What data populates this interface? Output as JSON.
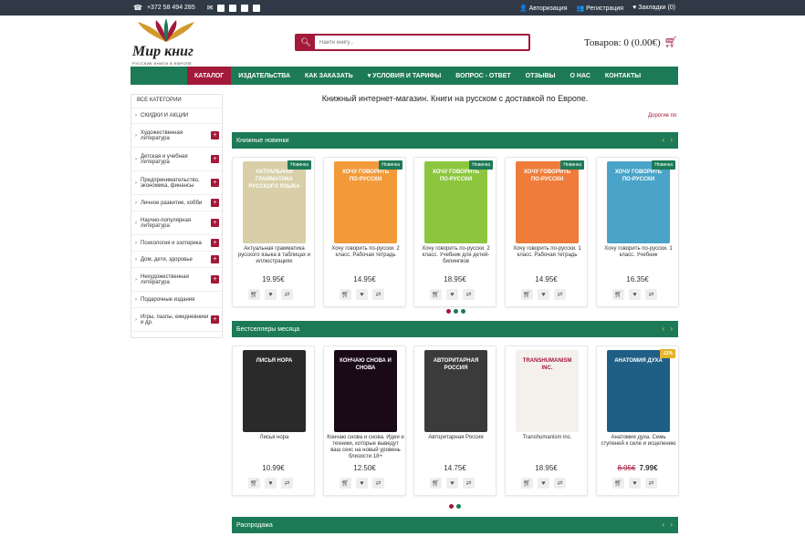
{
  "topbar": {
    "phone": "+372 58 494 285",
    "login": "Авторизация",
    "register": "Регистрация",
    "bookmarks": "Закладки (0)"
  },
  "logo": {
    "title": "Мир книг",
    "subtitle": "РУССКИЕ КНИГИ В ЕВРОПЕ"
  },
  "search": {
    "placeholder": "Найти книгу..."
  },
  "cart": {
    "label": "Товаров: 0 (0.00€)"
  },
  "nav": [
    "КАТАЛОГ",
    "ИЗДАТЕЛЬСТВА",
    "КАК ЗАКАЗАТЬ",
    "▾ УСЛОВИЯ И ТАРИФЫ",
    "ВОПРОС - ОТВЕТ",
    "ОТЗЫВЫ",
    "О НАС",
    "КОНТАКТЫ"
  ],
  "sidebar": {
    "header": "ВСЕ КАТЕГОРИИ",
    "items": [
      {
        "label": "СКИДКИ И АКЦИИ",
        "plus": false
      },
      {
        "label": "Художественная литература",
        "plus": true
      },
      {
        "label": "Детская и учебная литература",
        "plus": true
      },
      {
        "label": "Предпринимательство, экономика, финансы",
        "plus": true
      },
      {
        "label": "Личное развитие, хобби",
        "plus": true
      },
      {
        "label": "Научно-популярная литература",
        "plus": true
      },
      {
        "label": "Психология и эзотерика",
        "plus": true
      },
      {
        "label": "Дом, дети, здоровье",
        "plus": true
      },
      {
        "label": "Нехудожественная литература",
        "plus": true
      },
      {
        "label": "Подарочные издания",
        "plus": false
      },
      {
        "label": "Игры, пазлы, ежедневники и др.",
        "plus": true
      }
    ]
  },
  "hero": {
    "text": "Книжный интернет-магазин. Книги на русском с доставкой по Европе.",
    "ticker": "Дорогие по"
  },
  "sections": {
    "new": "Книжные новинки",
    "best": "Бестселлеры месяца",
    "sale": "Распродажа"
  },
  "new_books": [
    {
      "title": "Актуальная грамматика русского языка в таблицах и иллюстрациях",
      "price": "19.95€",
      "badge": "Новинка",
      "cover": "#d8cfa8",
      "cover_text": "АКТУАЛЬНАЯ ГРАММАТИКА РУССКОГО ЯЗЫКА"
    },
    {
      "title": "Хочу говорить по-русски. 2 класс. Рабочая тетрадь",
      "price": "14.95€",
      "badge": "Новинка",
      "cover": "#f29a3a",
      "cover_text": "ХОЧУ ГОВОРИТЬ ПО-РУССКИ"
    },
    {
      "title": "Хочу говорить по-русски. 2 класс. Учебник для детей-билингвов",
      "price": "18.95€",
      "badge": "Новинка",
      "cover": "#8cc63f",
      "cover_text": "ХОЧУ ГОВОРИТЬ ПО-РУССКИ"
    },
    {
      "title": "Хочу говорить по-русски. 1 класс. Рабочая тетрадь",
      "price": "14.95€",
      "badge": "Новинка",
      "cover": "#ef7c3a",
      "cover_text": "ХОЧУ ГОВОРИТЬ ПО-РУССКИ"
    },
    {
      "title": "Хочу говорить по-русски. 1 класс. Учебник",
      "price": "16.35€",
      "badge": "Новинка",
      "cover": "#4aa3c8",
      "cover_text": "ХОЧУ ГОВОРИТЬ ПО-РУССКИ"
    }
  ],
  "best_books": [
    {
      "title": "Лисья нора",
      "price": "10.99€",
      "old_price": "",
      "badge": "",
      "cover": "#2a2a2a",
      "cover_text": "ЛИСЬЯ НОРА"
    },
    {
      "title": "Кончаю снова и снова. Идеи и техники, которые выведут ваш секс на новый уровень близости 18+",
      "price": "12.50€",
      "old_price": "",
      "badge": "",
      "cover": "#1a0a18",
      "cover_text": "КОНЧАЮ СНОВА И СНОВА"
    },
    {
      "title": "Авторитарная Россия",
      "price": "14.75€",
      "old_price": "",
      "badge": "",
      "cover": "#3b3b3b",
      "cover_text": "АВТОРИТАРНАЯ РОССИЯ"
    },
    {
      "title": "Transhumanism inc.",
      "price": "18.95€",
      "old_price": "",
      "badge": "",
      "cover": "#f4f1ec",
      "cover_text": "TRANSHUMANISM INC."
    },
    {
      "title": "Анатомия духа. Семь ступеней к силе и исцелению",
      "price": "7.99€",
      "old_price": "8.95€",
      "badge": "-11%",
      "cover": "#1f5f86",
      "cover_text": "АНАТОМИЯ ДУХА"
    }
  ],
  "colors": {
    "accent": "#a3193a",
    "green": "#1d7a57",
    "topbar": "#2f3a46"
  }
}
